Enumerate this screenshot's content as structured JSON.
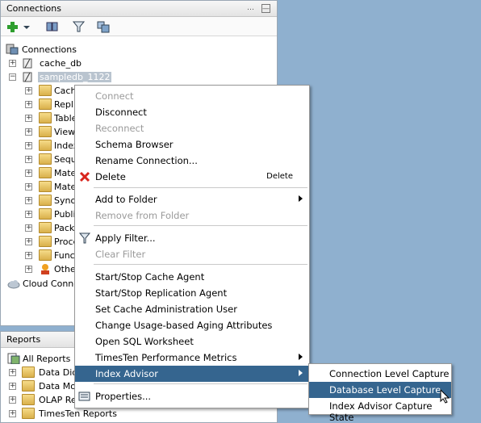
{
  "connections_panel": {
    "title": "Connections",
    "root_label": "Connections",
    "items": [
      {
        "label": "cache_db"
      },
      {
        "label": "sampledb_1122"
      }
    ],
    "children": [
      "Cach",
      "Repli",
      "Table",
      "Views",
      "Index",
      "Sequ",
      "Mate",
      "Mate",
      "Syno",
      "Publi",
      "Packa",
      "Proce",
      "Func",
      "Othe"
    ],
    "cloud_label": "Cloud Connec"
  },
  "reports_panel": {
    "title": "Reports",
    "items": [
      {
        "label": "All Reports"
      },
      {
        "label": "Data Dict"
      },
      {
        "label": "Data Mod"
      },
      {
        "label": "OLAP Rep"
      },
      {
        "label": "TimesTen Reports"
      }
    ]
  },
  "context_menu": {
    "items": [
      {
        "label": "Connect",
        "disabled": true
      },
      {
        "label": "Disconnect"
      },
      {
        "label": "Reconnect",
        "disabled": true
      },
      {
        "label": "Schema Browser"
      },
      {
        "label": "Rename Connection..."
      },
      {
        "label": "Delete",
        "accel": "Delete"
      },
      {
        "label": "Add to Folder"
      },
      {
        "label": "Remove from Folder",
        "disabled": true
      },
      {
        "label": "Apply Filter..."
      },
      {
        "label": "Clear Filter",
        "disabled": true
      },
      {
        "label": "Start/Stop Cache Agent"
      },
      {
        "label": "Start/Stop Replication Agent"
      },
      {
        "label": "Set Cache Administration User"
      },
      {
        "label": "Change Usage-based Aging Attributes"
      },
      {
        "label": "Open SQL Worksheet"
      },
      {
        "label": "TimesTen Performance Metrics"
      },
      {
        "label": "Index Advisor"
      },
      {
        "label": "Properties..."
      }
    ]
  },
  "submenu": {
    "items": [
      {
        "label": "Connection Level Capture"
      },
      {
        "label": "Database Level Capture"
      },
      {
        "label": "Index Advisor Capture State"
      }
    ]
  },
  "colors": {
    "selection": "#35658f",
    "desktop": "#8fb0cf",
    "disabled_text": "#9a9a9a"
  }
}
